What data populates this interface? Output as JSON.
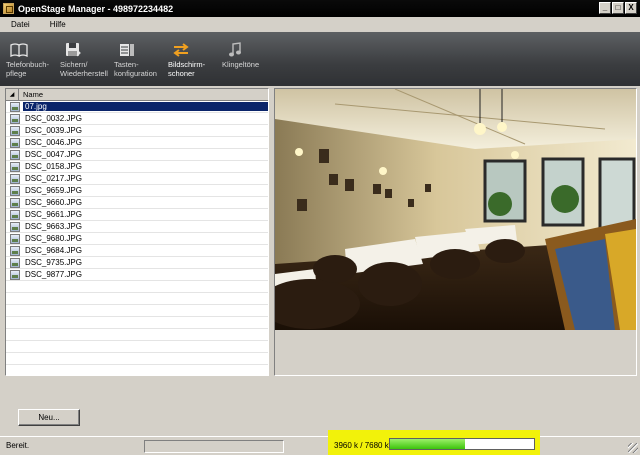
{
  "window": {
    "title": "OpenStage Manager - 498972234482",
    "controls": [
      "_",
      "□",
      "X"
    ]
  },
  "menu": {
    "items": [
      "Datei",
      "Hilfe"
    ]
  },
  "toolbar": {
    "items": [
      {
        "label": "Telefonbuch-\npflege",
        "icon": "book-icon"
      },
      {
        "label": "Sichern/\nWiederherstell",
        "icon": "save-icon"
      },
      {
        "label": "Tasten-\nkonfiguration",
        "icon": "keys-icon"
      },
      {
        "label": "Bildschirm-\nschoner",
        "icon": "screensaver-icon",
        "active": true
      },
      {
        "label": "Klingeltöne",
        "icon": "music-note-icon"
      }
    ]
  },
  "filelist": {
    "column": "Name",
    "files": [
      "07.jpg",
      "DSC_0032.JPG",
      "DSC_0039.JPG",
      "DSC_0046.JPG",
      "DSC_0047.JPG",
      "DSC_0158.JPG",
      "DSC_0217.JPG",
      "DSC_9659.JPG",
      "DSC_9660.JPG",
      "DSC_9661.JPG",
      "DSC_9663.JPG",
      "DSC_9680.JPG",
      "DSC_9684.JPG",
      "DSC_9735.JPG",
      "DSC_9877.JPG"
    ],
    "selected_index": 0
  },
  "buttons": {
    "new_label": "Neu..."
  },
  "status": {
    "text": "Bereit.",
    "memory_text": "3960 k / 7680 k",
    "memory_fraction": 0.52
  },
  "colors": {
    "toolbar": "#3b3d40",
    "selection": "#0a246a",
    "highlight": "#f2f20a",
    "progress": "#3cc40c"
  }
}
